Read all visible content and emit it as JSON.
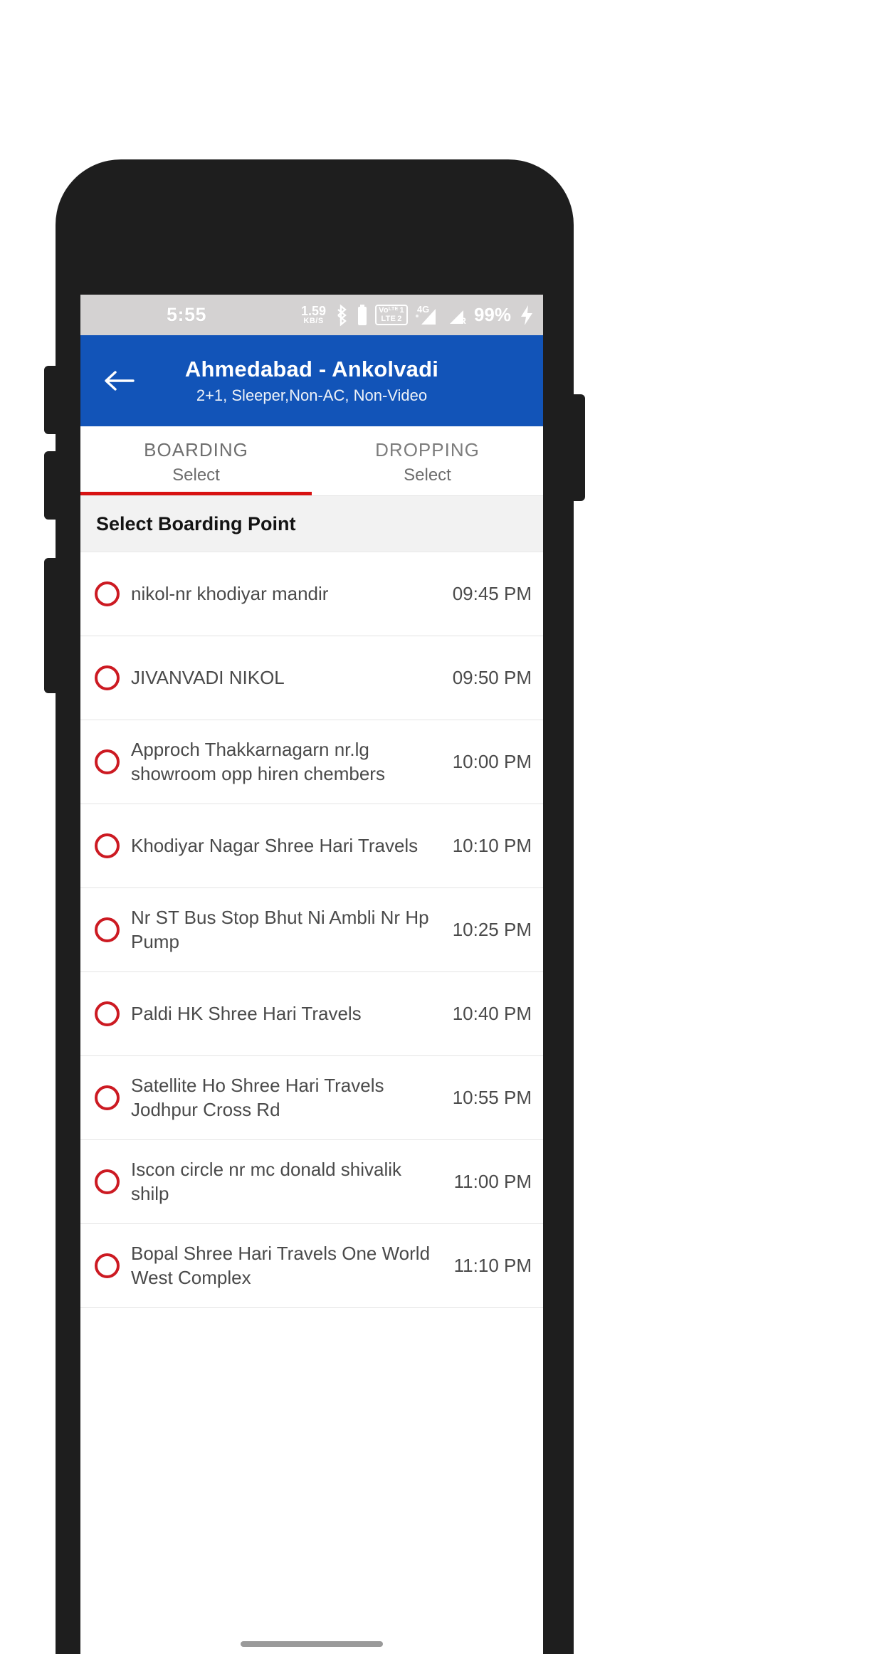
{
  "status_bar": {
    "time": "5:55",
    "net_speed_value": "1.59",
    "net_speed_unit": "KB/S",
    "bluetooth_icon": "bluetooth-icon",
    "volte_top": "Vo",
    "volte_top_sup": "LTE",
    "volte_slot_top": "1",
    "volte_bottom": "LTE",
    "volte_slot_bottom": "2",
    "network_type": "4G",
    "roaming_label": "R",
    "battery_percent": "99%",
    "charging_icon": "charging-bolt-icon",
    "background_color": "#d4d2d2"
  },
  "app_bar": {
    "back_icon": "back-arrow-icon",
    "title": "Ahmedabad - Ankolvadi",
    "subtitle": "2+1, Sleeper,Non-AC, Non-Video",
    "background_color": "#1254b8"
  },
  "tabs": [
    {
      "label": "BOARDING",
      "sub": "Select",
      "active": true
    },
    {
      "label": "DROPPING",
      "sub": "Select",
      "active": false
    }
  ],
  "tab_indicator_color": "#d81212",
  "section": {
    "header": "Select Boarding Point"
  },
  "radio_color": "#cc1a22",
  "boarding_points": [
    {
      "name": "nikol-nr khodiyar mandir",
      "time": "09:45 PM",
      "selected": false
    },
    {
      "name": "JIVANVADI NIKOL",
      "time": "09:50 PM",
      "selected": false
    },
    {
      "name": "Approch Thakkarnagarn nr.lg showroom opp hiren chembers",
      "time": "10:00 PM",
      "selected": false
    },
    {
      "name": "Khodiyar Nagar Shree Hari Travels",
      "time": "10:10 PM",
      "selected": false
    },
    {
      "name": "Nr ST Bus Stop Bhut Ni Ambli Nr Hp Pump",
      "time": "10:25 PM",
      "selected": false
    },
    {
      "name": "Paldi HK Shree Hari Travels",
      "time": "10:40 PM",
      "selected": false
    },
    {
      "name": "Satellite Ho Shree Hari Travels Jodhpur Cross Rd",
      "time": "10:55 PM",
      "selected": false
    },
    {
      "name": "Iscon circle nr mc donald shivalik shilp",
      "time": "11:00 PM",
      "selected": false
    },
    {
      "name": "Bopal Shree Hari Travels One World West Complex",
      "time": "11:10 PM",
      "selected": false
    }
  ]
}
